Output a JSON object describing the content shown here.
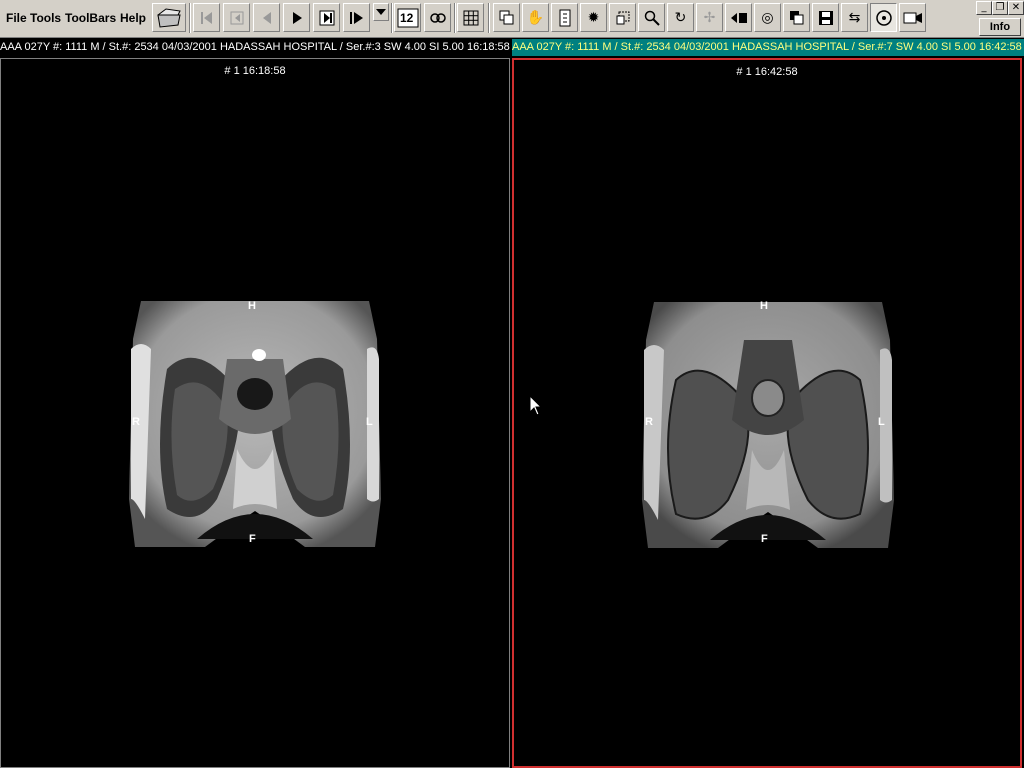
{
  "menu": {
    "file": "File",
    "tools": "Tools",
    "toolbars": "ToolBars",
    "help": "Help"
  },
  "toolbar": {
    "icons": [
      "open-folder",
      "first-frame",
      "frame-step-back",
      "previous",
      "play",
      "frame-step",
      "next",
      "dropdown",
      "one-two-layout",
      "link",
      "grid-layout",
      "multi-window",
      "pan-hand",
      "window-level",
      "settings-gear",
      "crop",
      "zoom",
      "rotate",
      "crosshair",
      "flip",
      "cine-loop",
      "overlay",
      "save",
      "swap",
      "target",
      "camera"
    ]
  },
  "window": {
    "info_label": "Info"
  },
  "viewports": {
    "left": {
      "header": "AAA 027Y #: 1111 M / St.#: 2534 04/03/2001 HADASSAH HOSPITAL / Ser.#:3 SW 4.00 SI 5.00 16:18:58",
      "stamp": "# 1 16:18:58",
      "orient": {
        "top": "H",
        "bottom": "F",
        "left": "R",
        "right": "L"
      }
    },
    "right": {
      "header": "AAA 027Y #: 1111 M / St.#: 2534 04/03/2001 HADASSAH HOSPITAL / Ser.#:7 SW 4.00 SI 5.00 16:42:58",
      "stamp": "# 1 16:42:58",
      "orient": {
        "top": "H",
        "bottom": "F",
        "left": "R",
        "right": "L"
      }
    }
  },
  "colors": {
    "active_border": "#d03030",
    "active_header_bg": "#008080",
    "active_header_text": "#ffff80"
  }
}
